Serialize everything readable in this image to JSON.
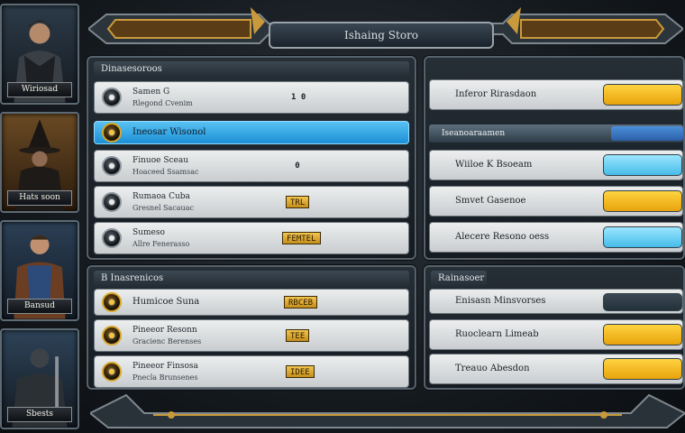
{
  "header": {
    "title": "Ishaing Storo"
  },
  "portraits": [
    {
      "name": "Wiriosad"
    },
    {
      "name": "Hats soon"
    },
    {
      "name": "Bansud"
    },
    {
      "name": "Sbests"
    }
  ],
  "skills_panel": {
    "header": "Dinasesoroos",
    "rows": [
      {
        "line1": "Samen G",
        "line2": "Rlegond Cvenim",
        "value": "1 0"
      },
      {
        "line1": "Ineosar Wisonol",
        "selected": true
      },
      {
        "line1": "Finuoe Sceau",
        "line2": "Hoaceed Ssamsac",
        "value": "0"
      },
      {
        "line1": "Rumaoa Cuba",
        "line2": "Gresnel Sacauac",
        "value": "TRL"
      },
      {
        "line1": "Sumeso",
        "line2": "Allre Fenerasso",
        "value": "FEMTEL"
      }
    ]
  },
  "abilities_panel": {
    "header": "B Inasrenicos",
    "rows": [
      {
        "line1": "Humicoe Suna",
        "value": "RBCEB"
      },
      {
        "line1": "Pineeor Resonn",
        "line2": "Gracienc Berenses",
        "value": "TEE"
      },
      {
        "line1": "Pineeor Finsosa",
        "line2": "Pnecla Brunsenes",
        "value": "IDEE"
      }
    ]
  },
  "stats_panel": {
    "rows": [
      {
        "label": "Inferor Rirasdaon",
        "bar": "gold"
      }
    ],
    "subheader": "Iseanoaraamen",
    "subrows": [
      {
        "label": "Wiiloe K Bsoeam",
        "bar": "blue"
      },
      {
        "label": "Smvet Gasenoe",
        "bar": "gold"
      },
      {
        "label": "Alecere Resono oess",
        "bar": "blue"
      }
    ]
  },
  "status_panel": {
    "header": "Rainasoer",
    "rows": [
      {
        "label": "Enisasn Minsvorses",
        "bar": "dark"
      },
      {
        "label": "Ruoclearn Limeab",
        "bar": "gold"
      },
      {
        "label": "Treauo Abesdon",
        "bar": "gold"
      }
    ]
  },
  "colors": {
    "accent_gold": "#f3c54e",
    "accent_blue": "#46bbe9",
    "panel_frame": "#56626b"
  }
}
